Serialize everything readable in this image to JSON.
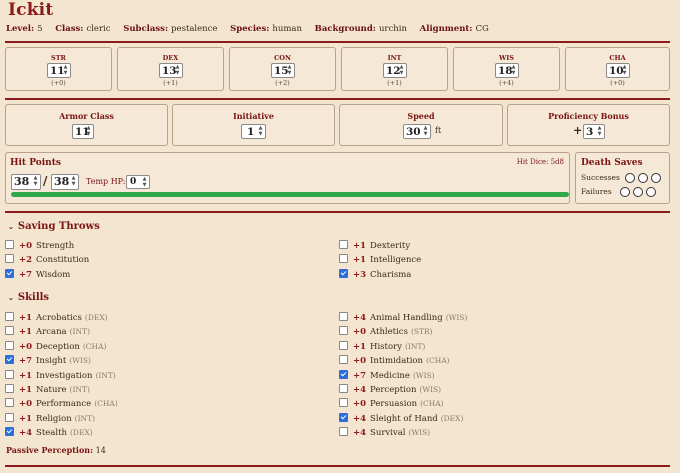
{
  "character": {
    "name": "Ickit",
    "info": [
      {
        "label": "Level:",
        "value": "5"
      },
      {
        "label": "Class:",
        "value": "cleric"
      },
      {
        "label": "Subclass:",
        "value": "pestalence"
      },
      {
        "label": "Species:",
        "value": "human"
      },
      {
        "label": "Background:",
        "value": "urchin"
      },
      {
        "label": "Alignment:",
        "value": "CG"
      }
    ]
  },
  "abilities": [
    {
      "name": "STR",
      "score": "11",
      "mod": "(+0)"
    },
    {
      "name": "DEX",
      "score": "13",
      "mod": "(+1)"
    },
    {
      "name": "CON",
      "score": "15",
      "mod": "(+2)"
    },
    {
      "name": "INT",
      "score": "12",
      "mod": "(+1)"
    },
    {
      "name": "WIS",
      "score": "18",
      "mod": "(+4)"
    },
    {
      "name": "CHA",
      "score": "10",
      "mod": "(+0)"
    }
  ],
  "stats": {
    "armor_class": {
      "label": "Armor Class",
      "value": "11"
    },
    "initiative": {
      "label": "Initiative",
      "value": "1"
    },
    "speed": {
      "label": "Speed",
      "value": "30",
      "unit": "ft"
    },
    "proficiency": {
      "label": "Proficiency Bonus",
      "prefix": "+",
      "value": "3"
    }
  },
  "hp": {
    "title": "Hit Points",
    "hit_dice": "Hit Dice: 5d8",
    "current": "38",
    "separator": "/",
    "max": "38",
    "temp_label": "Temp HP:",
    "temp": "0",
    "fill_fraction": 1.0,
    "bar_color": "#2ea84a"
  },
  "death_saves": {
    "title": "Death Saves",
    "successes_label": "Successes",
    "failures_label": "Failures"
  },
  "saving_throws": {
    "title": "Saving Throws",
    "items": [
      {
        "bonus": "+0",
        "name": "Strength",
        "checked": false
      },
      {
        "bonus": "+2",
        "name": "Constitution",
        "checked": false
      },
      {
        "bonus": "+7",
        "name": "Wisdom",
        "checked": true
      },
      {
        "bonus": "+1",
        "name": "Dexterity",
        "checked": false
      },
      {
        "bonus": "+1",
        "name": "Intelligence",
        "checked": false
      },
      {
        "bonus": "+3",
        "name": "Charisma",
        "checked": true
      }
    ]
  },
  "skills": {
    "title": "Skills",
    "items": [
      {
        "bonus": "+1",
        "name": "Acrobatics",
        "abbr": "(DEX)",
        "checked": false
      },
      {
        "bonus": "+1",
        "name": "Arcana",
        "abbr": "(INT)",
        "checked": false
      },
      {
        "bonus": "+0",
        "name": "Deception",
        "abbr": "(CHA)",
        "checked": false
      },
      {
        "bonus": "+7",
        "name": "Insight",
        "abbr": "(WIS)",
        "checked": true
      },
      {
        "bonus": "+1",
        "name": "Investigation",
        "abbr": "(INT)",
        "checked": false
      },
      {
        "bonus": "+1",
        "name": "Nature",
        "abbr": "(INT)",
        "checked": false
      },
      {
        "bonus": "+0",
        "name": "Performance",
        "abbr": "(CHA)",
        "checked": false
      },
      {
        "bonus": "+1",
        "name": "Religion",
        "abbr": "(INT)",
        "checked": false
      },
      {
        "bonus": "+4",
        "name": "Stealth",
        "abbr": "(DEX)",
        "checked": true
      },
      {
        "bonus": "+4",
        "name": "Animal Handling",
        "abbr": "(WIS)",
        "checked": false
      },
      {
        "bonus": "+0",
        "name": "Athletics",
        "abbr": "(STR)",
        "checked": false
      },
      {
        "bonus": "+1",
        "name": "History",
        "abbr": "(INT)",
        "checked": false
      },
      {
        "bonus": "+0",
        "name": "Intimidation",
        "abbr": "(CHA)",
        "checked": false
      },
      {
        "bonus": "+7",
        "name": "Medicine",
        "abbr": "(WIS)",
        "checked": true
      },
      {
        "bonus": "+4",
        "name": "Perception",
        "abbr": "(WIS)",
        "checked": false
      },
      {
        "bonus": "+0",
        "name": "Persuasion",
        "abbr": "(CHA)",
        "checked": false
      },
      {
        "bonus": "+4",
        "name": "Sleight of Hand",
        "abbr": "(DEX)",
        "checked": true
      },
      {
        "bonus": "+4",
        "name": "Survival",
        "abbr": "(WIS)",
        "checked": false
      }
    ]
  },
  "passive": {
    "label": "Passive Perception:",
    "value": "14"
  },
  "colors": {
    "accent": "#8b1a1a",
    "background": "#f3e5cf",
    "checkbox_on": "#2c6fd6"
  }
}
